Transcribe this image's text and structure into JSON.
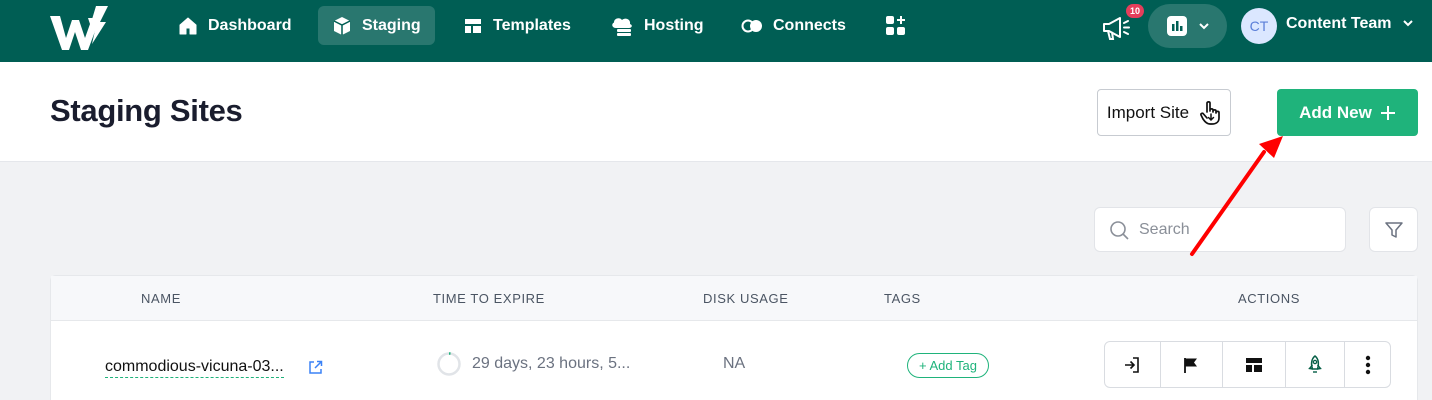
{
  "nav": {
    "items": [
      {
        "label": "Dashboard",
        "icon": "home-icon"
      },
      {
        "label": "Staging",
        "icon": "cube-icon",
        "active": true
      },
      {
        "label": "Templates",
        "icon": "layout-icon"
      },
      {
        "label": "Hosting",
        "icon": "cloud-server-icon"
      },
      {
        "label": "Connects",
        "icon": "toggle-icon"
      }
    ],
    "apps_icon": "apps-grid-plus-icon",
    "notification_count": "10",
    "user_initials": "CT",
    "user_name": "Content Team"
  },
  "header": {
    "title": "Staging Sites",
    "import_label": "Import Site",
    "add_label": "Add New"
  },
  "search": {
    "placeholder": "Search"
  },
  "table": {
    "columns": [
      "NAME",
      "TIME TO EXPIRE",
      "DISK USAGE",
      "TAGS",
      "ACTIONS"
    ],
    "rows": [
      {
        "name": "commodious-vicuna-03...",
        "time_to_expire": "29 days, 23 hours, 5...",
        "disk_usage": "NA",
        "tag_label": "+ Add Tag"
      }
    ]
  },
  "colors": {
    "nav_bg": "#005e54",
    "primary_green": "#1fb37b",
    "badge_red": "#e53e5b",
    "annotation_arrow": "#ff0000"
  }
}
